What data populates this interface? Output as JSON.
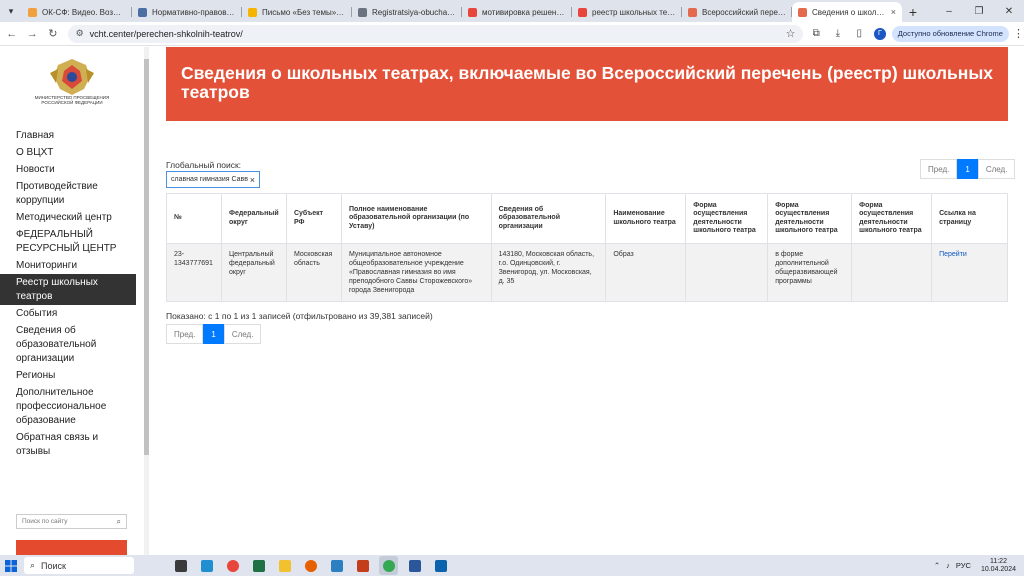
{
  "browser": {
    "tabs": [
      {
        "title": "ОК-СФ: Видео. Возможн",
        "color": "#f0a03c"
      },
      {
        "title": "Нормативно-правовое о",
        "color": "#4a6fa5"
      },
      {
        "title": "Письмо «Без темы» —",
        "color": "#f4b400"
      },
      {
        "title": "Registratsiya-obuchayush",
        "color": "#6b7280"
      },
      {
        "title": "мотивировка решения с",
        "color": "#e8453c"
      },
      {
        "title": "реестр школьных театр",
        "color": "#e8453c"
      },
      {
        "title": "Всероссийский перечень",
        "color": "#e36a4d"
      },
      {
        "title": "Сведения о школьных т",
        "color": "#e36a4d",
        "active": true
      }
    ],
    "url": "vcht.center/perechen-shkolnih-teatrov/",
    "profile_initial": "Г",
    "update_label": "Доступно обновление Chrome"
  },
  "sidebar": {
    "logo_text": "МИНИСТЕРСТВО ПРОСВЕЩЕНИЯ РОССИЙСКОЙ ФЕДЕРАЦИИ",
    "items": [
      {
        "label": "Главная"
      },
      {
        "label": "О ВЦХТ"
      },
      {
        "label": "Новости"
      },
      {
        "label": "Противодействие коррупции"
      },
      {
        "label": "Методический центр"
      },
      {
        "label": "ФЕДЕРАЛЬНЫЙ РЕСУРСНЫЙ ЦЕНТР"
      },
      {
        "label": "Мониторинги"
      },
      {
        "label": "Реестр школьных театров",
        "active": true
      },
      {
        "label": "События"
      },
      {
        "label": "Сведения об образовательной организации"
      },
      {
        "label": "Регионы"
      },
      {
        "label": "Дополнительное профессиональное образование"
      },
      {
        "label": "Обратная связь и отзывы"
      }
    ],
    "search_placeholder": "Поиск по сайту"
  },
  "main": {
    "title": "Сведения о школьных театрах, включаемые во Всероссийский перечень (реестр) школьных театров",
    "global_search_label": "Глобальный поиск:",
    "global_search_value": "славная гимназия Савв",
    "pager": {
      "prev": "Пред.",
      "current": "1",
      "next": "След."
    },
    "columns": [
      "№",
      "Федеральный округ",
      "Субъект РФ",
      "Полное наименование образовательной организации (по Уставу)",
      "Сведения об образовательной организации",
      "Наименование школьного театра",
      "Форма осуществления деятельности школьного театра",
      "Форма осуществления деятельности школьного театра",
      "Форма осуществления деятельности школьного театра",
      "Ссылка на страницу"
    ],
    "rows": [
      [
        "23-1343777691",
        "Центральный федеральный округ",
        "Московская область",
        "Муниципальное автономное общеобразовательное учреждение «Православная гимназия во имя преподобного Саввы Сторожевского» города Звенигорода",
        "143180, Московская область, г.о. Одинцовский, г. Звенигород, ул. Московская, д. 35",
        "Образ",
        "",
        "в форме дополнительной общеразвивающей программы",
        "",
        "Перейти"
      ]
    ],
    "info": "Показано: с 1 по 1 из 1 записей (отфильтровано из 39,381 записей)"
  },
  "taskbar": {
    "search_label": "Поиск",
    "apps": [
      {
        "name": "task-view",
        "color": "#3b3b3b"
      },
      {
        "name": "edge",
        "color": "#1f8fd1"
      },
      {
        "name": "yandex",
        "color": "#e8453c"
      },
      {
        "name": "excel",
        "color": "#1e7145"
      },
      {
        "name": "explorer",
        "color": "#f2c12e"
      },
      {
        "name": "firefox",
        "color": "#e66000"
      },
      {
        "name": "photos",
        "color": "#2c7fc1"
      },
      {
        "name": "powerpoint",
        "color": "#c43e1c"
      },
      {
        "name": "chrome",
        "color": "#34a853",
        "active": true
      },
      {
        "name": "word",
        "color": "#2b579a"
      },
      {
        "name": "outlook",
        "color": "#0a64ad"
      }
    ],
    "lang": "РУС",
    "time": "11:22",
    "date": "10.04.2024"
  }
}
